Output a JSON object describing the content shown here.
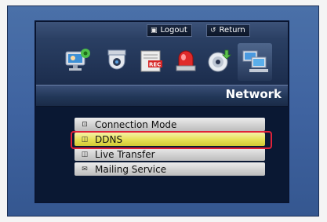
{
  "topbar": {
    "logout_label": "Logout",
    "return_label": "Return"
  },
  "toolbar_icons": [
    {
      "name": "system-setup-icon"
    },
    {
      "name": "camera-icon"
    },
    {
      "name": "record-icon"
    },
    {
      "name": "event-alarm-icon"
    },
    {
      "name": "backup-disc-icon"
    },
    {
      "name": "network-icon",
      "active": true
    }
  ],
  "header": {
    "title": "Network"
  },
  "menu": {
    "items": [
      {
        "label": "Connection Mode",
        "icon": "connection-icon",
        "selected": false
      },
      {
        "label": "DDNS",
        "icon": "ddns-icon",
        "selected": true
      },
      {
        "label": "Live Transfer",
        "icon": "live-transfer-icon",
        "selected": false
      },
      {
        "label": "Mailing Service",
        "icon": "mail-icon",
        "selected": false
      }
    ]
  },
  "colors": {
    "highlight_border": "#e0223a",
    "selected_row": "#e6df55",
    "bezel": "#4a70a8"
  }
}
